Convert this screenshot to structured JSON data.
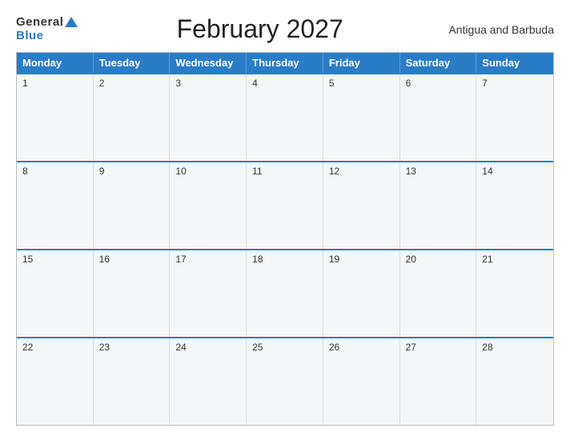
{
  "header": {
    "logo_general": "General",
    "logo_blue": "Blue",
    "title": "February 2027",
    "country": "Antigua and Barbuda"
  },
  "calendar": {
    "days_of_week": [
      "Monday",
      "Tuesday",
      "Wednesday",
      "Thursday",
      "Friday",
      "Saturday",
      "Sunday"
    ],
    "weeks": [
      [
        {
          "day": "1"
        },
        {
          "day": "2"
        },
        {
          "day": "3"
        },
        {
          "day": "4"
        },
        {
          "day": "5"
        },
        {
          "day": "6"
        },
        {
          "day": "7"
        }
      ],
      [
        {
          "day": "8"
        },
        {
          "day": "9"
        },
        {
          "day": "10"
        },
        {
          "day": "11"
        },
        {
          "day": "12"
        },
        {
          "day": "13"
        },
        {
          "day": "14"
        }
      ],
      [
        {
          "day": "15"
        },
        {
          "day": "16"
        },
        {
          "day": "17"
        },
        {
          "day": "18"
        },
        {
          "day": "19"
        },
        {
          "day": "20"
        },
        {
          "day": "21"
        }
      ],
      [
        {
          "day": "22"
        },
        {
          "day": "23"
        },
        {
          "day": "24"
        },
        {
          "day": "25"
        },
        {
          "day": "26"
        },
        {
          "day": "27"
        },
        {
          "day": "28"
        }
      ]
    ]
  }
}
